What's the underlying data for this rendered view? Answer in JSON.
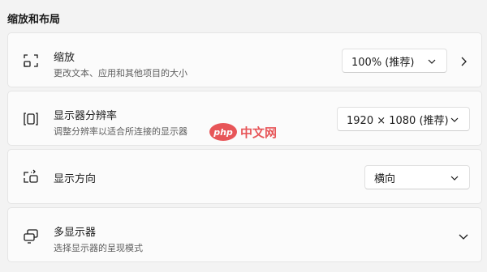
{
  "section": {
    "title": "缩放和布局"
  },
  "scale": {
    "title": "缩放",
    "description": "更改文本、应用和其他项目的大小",
    "value": "100% (推荐)",
    "icon": "scale-icon"
  },
  "resolution": {
    "title": "显示器分辨率",
    "description": "调整分辨率以适合所连接的显示器",
    "value": "1920 × 1080 (推荐)",
    "icon": "resolution-icon"
  },
  "orientation": {
    "title": "显示方向",
    "value": "横向",
    "icon": "orientation-icon"
  },
  "multiple_displays": {
    "title": "多显示器",
    "description": "选择显示器的呈现模式",
    "icon": "multiple-displays-icon"
  },
  "watermark": {
    "logo": "php",
    "text": "中文网"
  },
  "colors": {
    "background": "#f3f3f3",
    "card": "#fbfbfb",
    "watermark": "#e4393c"
  }
}
